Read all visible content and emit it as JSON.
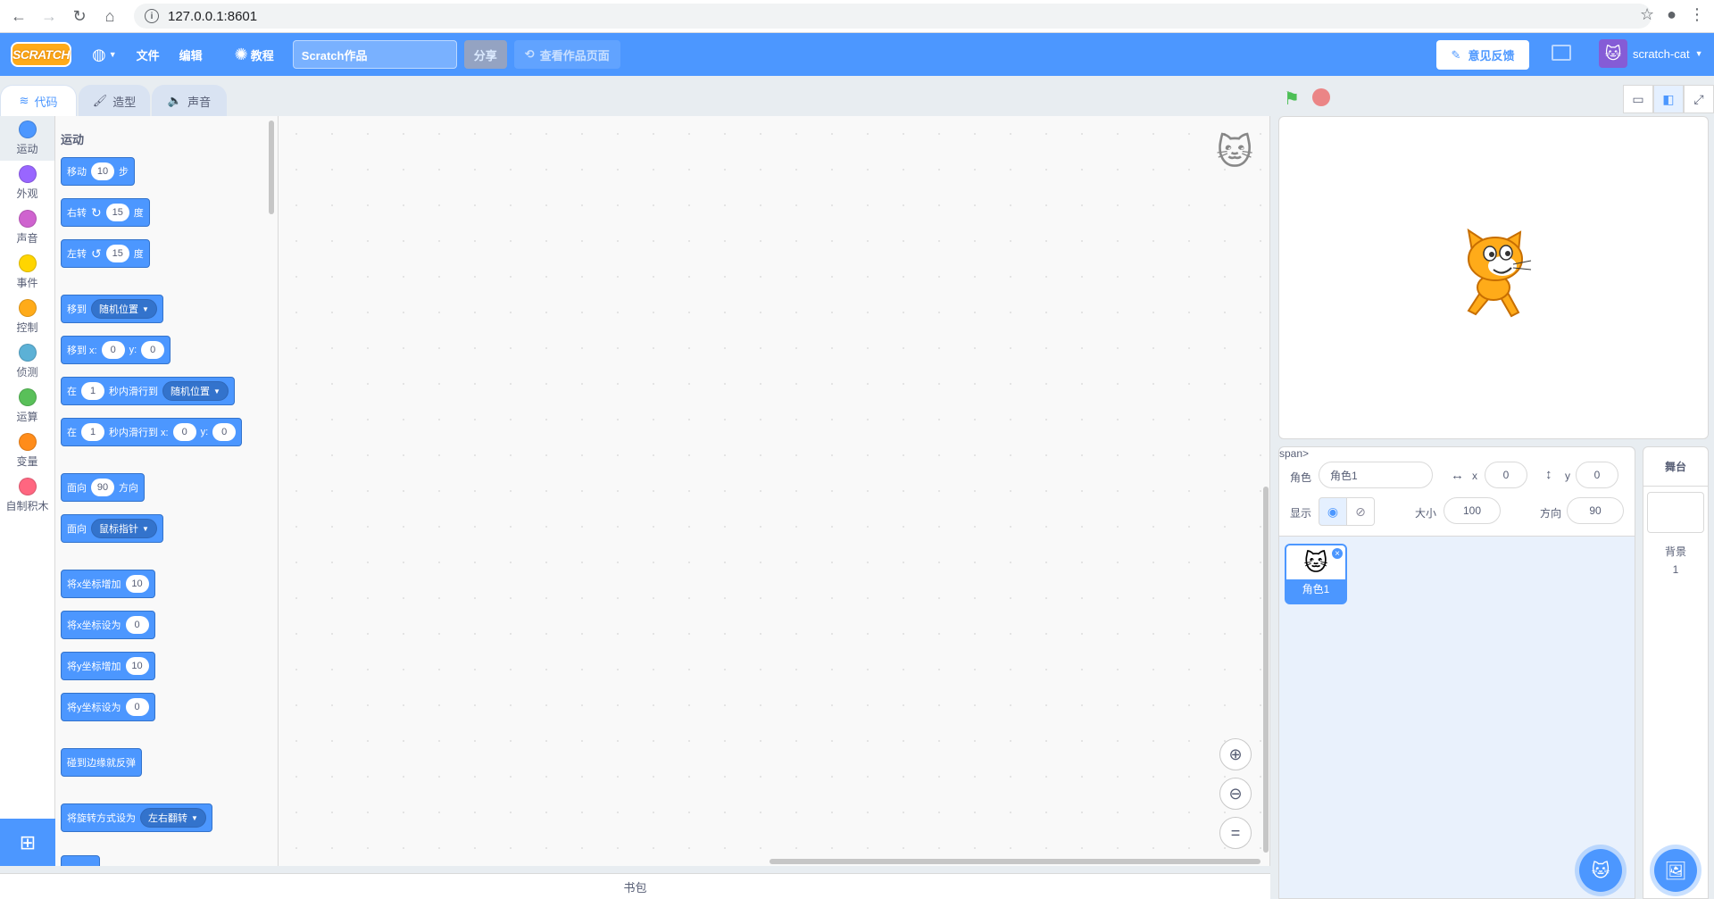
{
  "browser": {
    "url": "127.0.0.1:8601"
  },
  "menu": {
    "logo": "SCRATCH",
    "file": "文件",
    "edit": "编辑",
    "tutorials": "教程",
    "project_title": "Scratch作品",
    "share": "分享",
    "see_project": "查看作品页面",
    "feedback": "意见反馈",
    "username": "scratch-cat"
  },
  "tabs": [
    {
      "label": "代码"
    },
    {
      "label": "造型"
    },
    {
      "label": "声音"
    }
  ],
  "categories": [
    {
      "label": "运动",
      "color": "#4c97ff"
    },
    {
      "label": "外观",
      "color": "#9966ff"
    },
    {
      "label": "声音",
      "color": "#cf63cf"
    },
    {
      "label": "事件",
      "color": "#ffd500"
    },
    {
      "label": "控制",
      "color": "#ffab19"
    },
    {
      "label": "侦测",
      "color": "#5cb1d6"
    },
    {
      "label": "运算",
      "color": "#59c059"
    },
    {
      "label": "变量",
      "color": "#ff8c1a"
    },
    {
      "label": "自制积木",
      "color": "#ff6680"
    }
  ],
  "palette": {
    "section_title": "运动",
    "blocks": {
      "move": {
        "a": "移动",
        "v": "10",
        "b": "步"
      },
      "turn_right": {
        "a": "右转",
        "v": "15",
        "b": "度"
      },
      "turn_left": {
        "a": "左转",
        "v": "15",
        "b": "度"
      },
      "goto": {
        "a": "移到",
        "d": "随机位置"
      },
      "goto_xy": {
        "a": "移到 x:",
        "x": "0",
        "b": "y:",
        "y": "0"
      },
      "glide": {
        "a": "在",
        "v": "1",
        "b": "秒内滑行到",
        "d": "随机位置"
      },
      "glide_xy": {
        "a": "在",
        "v": "1",
        "b": "秒内滑行到 x:",
        "x": "0",
        "c": "y:",
        "y": "0"
      },
      "point_dir": {
        "a": "面向",
        "v": "90",
        "b": "方向"
      },
      "point_towards": {
        "a": "面向",
        "d": "鼠标指针"
      },
      "change_x": {
        "a": "将x坐标增加",
        "v": "10"
      },
      "set_x": {
        "a": "将x坐标设为",
        "v": "0"
      },
      "change_y": {
        "a": "将y坐标增加",
        "v": "10"
      },
      "set_y": {
        "a": "将y坐标设为",
        "v": "0"
      },
      "bounce": {
        "a": "碰到边缘就反弹"
      },
      "rotation_style": {
        "a": "将旋转方式设为",
        "d": "左右翻转"
      }
    }
  },
  "backpack": "书包",
  "sprite_info": {
    "sprite_label": "角色",
    "sprite_name": "角色1",
    "x_label": "x",
    "x_value": "0",
    "y_label": "y",
    "y_value": "0",
    "show_label": "显示",
    "size_label": "大小",
    "size_value": "100",
    "direction_label": "方向",
    "direction_value": "90"
  },
  "sprites": [
    {
      "name": "角色1"
    }
  ],
  "stage_pane": {
    "title": "舞台",
    "backdrops_label": "背景",
    "backdrops_count": "1"
  }
}
